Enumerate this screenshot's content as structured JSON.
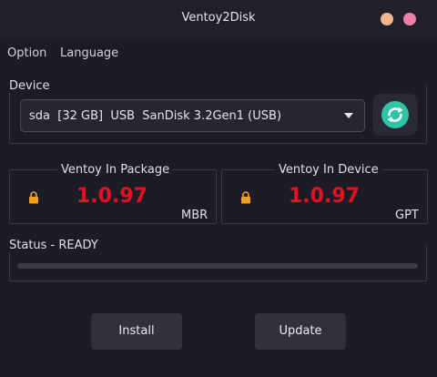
{
  "window": {
    "title": "Ventoy2Disk"
  },
  "menu": {
    "items": [
      "Option",
      "Language"
    ]
  },
  "device": {
    "label": "Device",
    "selected": "sda  [32 GB]  USB  SanDisk 3.2Gen1 (USB)"
  },
  "package": {
    "label": "Ventoy In Package",
    "version": "1.0.97",
    "partition_style": "MBR"
  },
  "installed": {
    "label": "Ventoy In Device",
    "version": "1.0.97",
    "partition_style": "GPT"
  },
  "status": {
    "label": "Status - READY",
    "progress": 0
  },
  "actions": {
    "install": "Install",
    "update": "Update"
  },
  "colors": {
    "version_text": "#e8101e",
    "accent": "#2ec4a6",
    "lock": "#f0a020",
    "minimize": "#f2b48c",
    "close": "#ef7fa3"
  }
}
